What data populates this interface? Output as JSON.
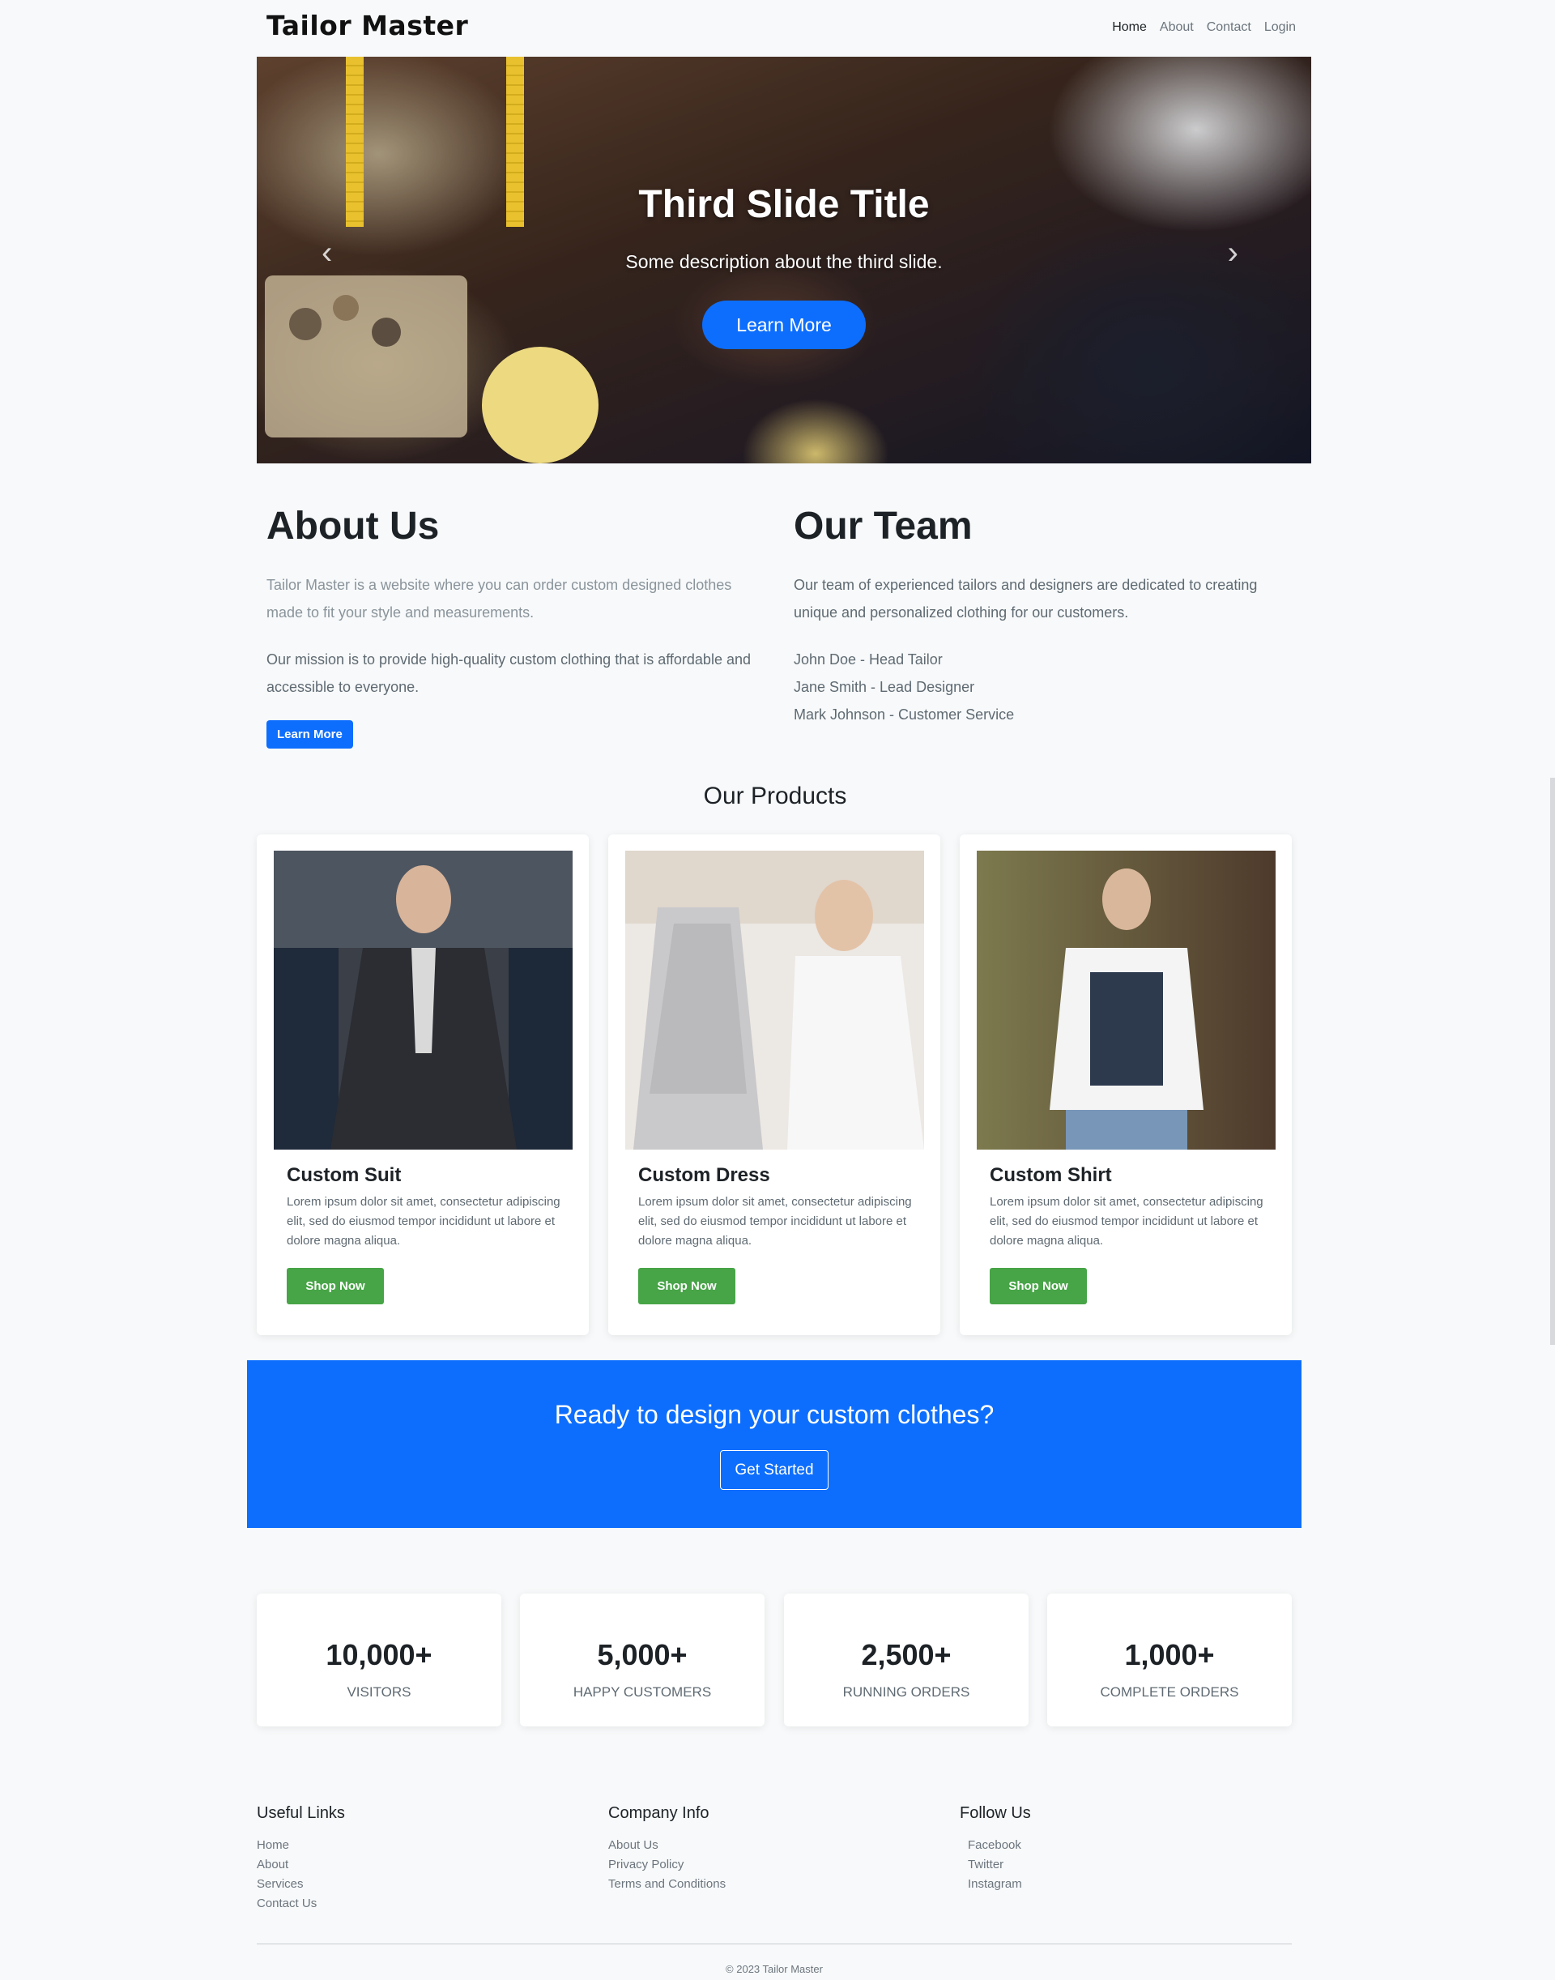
{
  "nav": {
    "brand": "Tailor Master",
    "links": [
      "Home",
      "About",
      "Contact",
      "Login"
    ]
  },
  "hero": {
    "title": "Third Slide Title",
    "description": "Some description about the third slide.",
    "button": "Learn More"
  },
  "about": {
    "title": "About Us",
    "p1": "Tailor Master is a website where you can order custom designed clothes made to fit your style and measurements.",
    "p2": "Our mission is to provide high-quality custom clothing that is affordable and accessible to everyone.",
    "button": "Learn More"
  },
  "team": {
    "title": "Our Team",
    "intro": "Our team of experienced tailors and designers are dedicated to creating unique and personalized clothing for our customers.",
    "members": [
      "John Doe - Head Tailor",
      "Jane Smith - Lead Designer",
      "Mark Johnson - Customer Service"
    ]
  },
  "products": {
    "title": "Our Products",
    "items": [
      {
        "name": "Custom Suit",
        "desc": "Lorem ipsum dolor sit amet, consectetur adipiscing elit, sed do eiusmod tempor incididunt ut labore et dolore magna aliqua.",
        "button": "Shop Now"
      },
      {
        "name": "Custom Dress",
        "desc": "Lorem ipsum dolor sit amet, consectetur adipiscing elit, sed do eiusmod tempor incididunt ut labore et dolore magna aliqua.",
        "button": "Shop Now"
      },
      {
        "name": "Custom Shirt",
        "desc": "Lorem ipsum dolor sit amet, consectetur adipiscing elit, sed do eiusmod tempor incididunt ut labore et dolore magna aliqua.",
        "button": "Shop Now"
      }
    ]
  },
  "cta": {
    "title": "Ready to design your custom clothes?",
    "button": "Get Started"
  },
  "stats": [
    {
      "value": "10,000+",
      "label": "VISITORS"
    },
    {
      "value": "5,000+",
      "label": "HAPPY CUSTOMERS"
    },
    {
      "value": "2,500+",
      "label": "RUNNING ORDERS"
    },
    {
      "value": "1,000+",
      "label": "COMPLETE ORDERS"
    }
  ],
  "footer": {
    "useful": {
      "title": "Useful Links",
      "links": [
        "Home",
        "About",
        "Services",
        "Contact Us"
      ]
    },
    "company": {
      "title": "Company Info",
      "links": [
        "About Us",
        "Privacy Policy",
        "Terms and Conditions"
      ]
    },
    "follow": {
      "title": "Follow Us",
      "links": [
        "Facebook",
        "Twitter",
        "Instagram"
      ]
    },
    "copyright": "© 2023 Tailor Master"
  },
  "colors": {
    "primary": "#0d6efd",
    "success": "#47a447",
    "background": "#f7f9fa"
  }
}
